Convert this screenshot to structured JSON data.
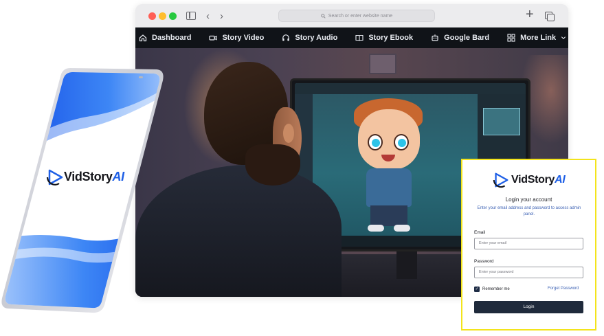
{
  "browser": {
    "address_placeholder": "Search or enter website name",
    "menu": [
      {
        "icon": "home-icon",
        "label": "Dashboard"
      },
      {
        "icon": "video-camera-icon",
        "label": "Story Video"
      },
      {
        "icon": "headphones-icon",
        "label": "Story Audio"
      },
      {
        "icon": "book-icon",
        "label": "Story Ebook"
      },
      {
        "icon": "robot-icon",
        "label": "Google Bard"
      },
      {
        "icon": "grid-icon",
        "label": "More Link"
      }
    ]
  },
  "brand": {
    "name_main": "VidStory",
    "name_accent": "AI",
    "accent_color": "#1e5fe6"
  },
  "login": {
    "heading": "Login your account",
    "subtitle": "Enter your email address and password to access admin panel.",
    "email_label": "Email",
    "email_placeholder": "Enter your email",
    "password_label": "Password",
    "password_placeholder": "Enter your password",
    "remember_label": "Remember me",
    "remember_checked": true,
    "forget_link": "Forget Password",
    "button_label": "Login",
    "border_color": "#f3e41c"
  }
}
